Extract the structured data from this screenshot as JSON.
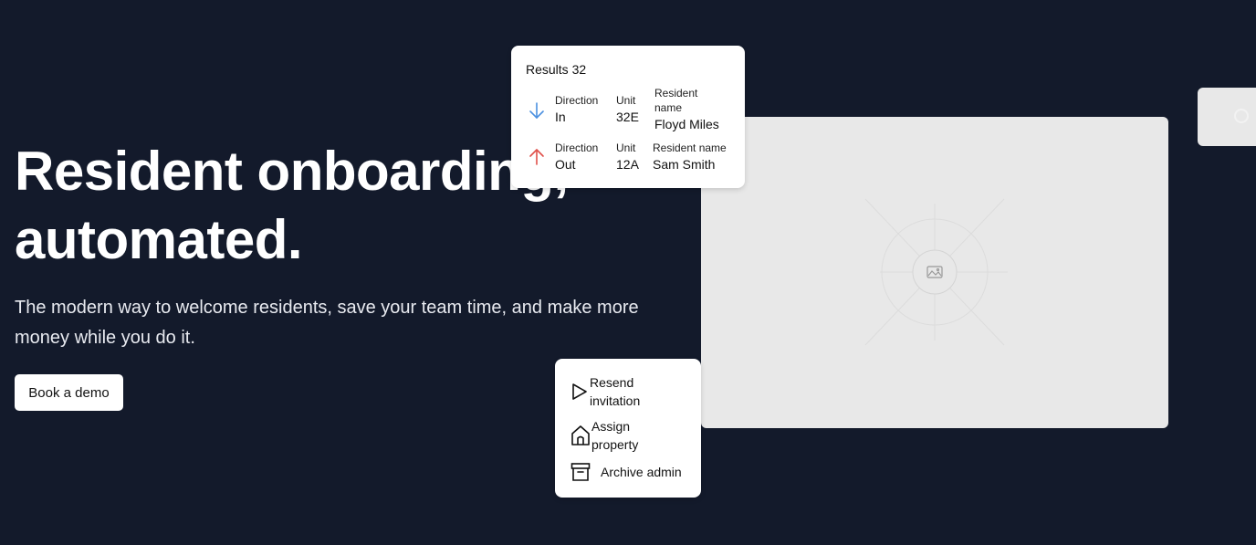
{
  "hero": {
    "title_line1": "Resident onboarding,",
    "title_line2": "automated.",
    "subtitle": "The modern way to welcome residents, save your team time, and make more money while you do it.",
    "cta_label": "Book a demo"
  },
  "results": {
    "title": "Results 32",
    "rows": [
      {
        "direction_label": "Direction",
        "direction": "In",
        "unit_label": "Unit",
        "unit": "32E",
        "resident_label": "Resident name",
        "resident": "Floyd Miles",
        "arrow_icon": "arrow-down-icon",
        "arrow_color": "#4a8fe0"
      },
      {
        "direction_label": "Direction",
        "direction": "Out",
        "unit_label": "Unit",
        "unit": "12A",
        "resident_label": "Resident name",
        "resident": "Sam Smith",
        "arrow_icon": "arrow-up-icon",
        "arrow_color": "#e0504a"
      }
    ]
  },
  "actions": [
    {
      "label": "Resend invitation",
      "icon": "play-icon"
    },
    {
      "label": "Assign property",
      "icon": "home-icon"
    },
    {
      "label": "Archive admin",
      "icon": "archive-icon"
    }
  ],
  "colors": {
    "background": "#131a2b",
    "card": "#ffffff",
    "placeholder": "#e8e8e8"
  }
}
